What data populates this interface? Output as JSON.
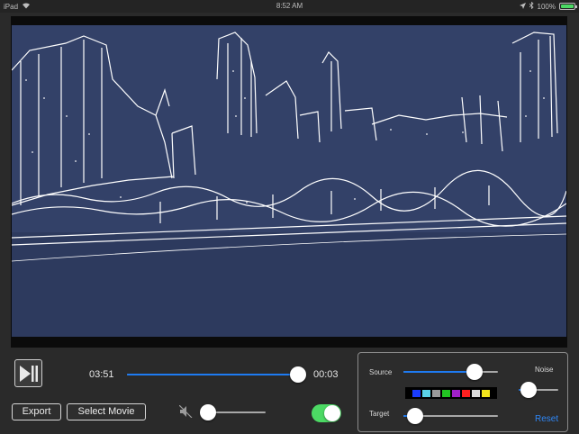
{
  "status_bar": {
    "device": "iPad",
    "time": "8:52 AM",
    "battery_text": "100%",
    "battery_level": 1.0
  },
  "player": {
    "elapsed": "03:51",
    "remaining": "00:03",
    "progress": 0.97
  },
  "buttons": {
    "export": "Export",
    "select_movie": "Select Movie"
  },
  "audio": {
    "volume": 0.0
  },
  "effect_toggle": {
    "on": true
  },
  "color_panel": {
    "source_label": "Source",
    "source_value": 0.75,
    "target_label": "Target",
    "target_value": 0.12,
    "noise_label": "Noise",
    "noise_value": 0.25,
    "reset_label": "Reset",
    "palette": [
      "#1a3cff",
      "#5ad1e8",
      "#9a9a9a",
      "#22c422",
      "#a020c8",
      "#ff2020",
      "#dcdcdc",
      "#f2e41c"
    ]
  },
  "colors": {
    "accent": "#1e7bf2",
    "toggle_on": "#4cd964",
    "video_background": "#334168",
    "edge_lines": "#ffffff"
  },
  "icons": {
    "play_pause": "play-pause-icon",
    "mute": "speaker-muted-icon",
    "wifi": "wifi-icon",
    "location": "location-arrow-icon",
    "bluetooth": "bluetooth-icon",
    "battery": "battery-icon"
  }
}
